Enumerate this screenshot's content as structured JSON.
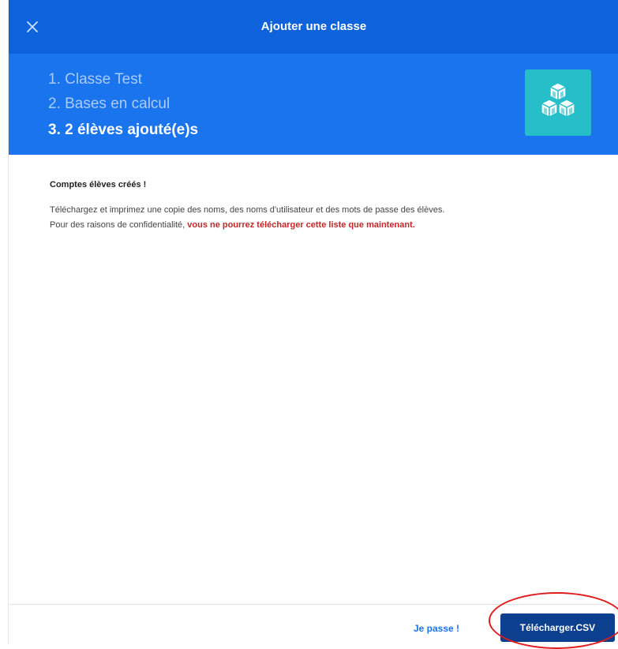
{
  "header": {
    "title": "Ajouter une classe",
    "close_icon": "close-icon",
    "color": "#0e63dc"
  },
  "steps": {
    "band_color": "#1a74ee",
    "items": [
      {
        "label": "1. Classe Test",
        "state": "done"
      },
      {
        "label": "2. Bases en calcul",
        "state": "done"
      },
      {
        "label": "3. 2 élèves ajouté(e)s",
        "state": "current"
      }
    ],
    "icon": "cubes-icon",
    "icon_color": "#26bfc9"
  },
  "content": {
    "heading": "Comptes élèves créés !",
    "line1": "Téléchargez et imprimez une copie des noms, des noms d'utilisateur et des mots de passe des élèves.",
    "line2_prefix": "Pour des raisons de confidentialité, ",
    "line2_warning": "vous ne pourrez télécharger cette liste que maintenant.",
    "warning_color": "#c3272a"
  },
  "footer": {
    "skip_label": "Je passe !",
    "download_label": "Télécharger.CSV",
    "download_color": "#0d3f8f",
    "highlight_color": "#e01b1b"
  }
}
